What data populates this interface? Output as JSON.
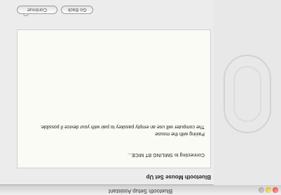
{
  "window": {
    "title": "Bluetooth Setup Assistant"
  },
  "heading": "Bluetooth Mouse Set Up",
  "status": "Connecting to SMILING BT MICE...",
  "body": {
    "line1": "Pairing with the mouse",
    "line2": "The computer will use an empty passkey to pair with your device if possible."
  },
  "buttons": {
    "back": "Go Back",
    "continue": "Continue"
  },
  "colors": {
    "close": "#d8382a",
    "minimize": "#d9a21d",
    "zoom": "#9a9a9a"
  }
}
